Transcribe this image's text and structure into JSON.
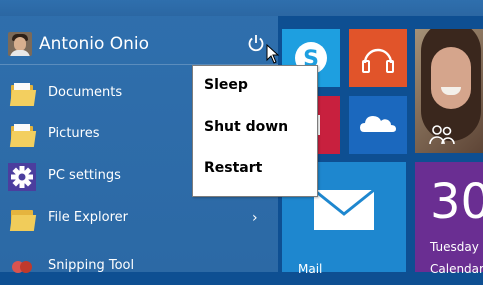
{
  "user": {
    "name": "Antonio Onio"
  },
  "power_menu": {
    "items": [
      "Sleep",
      "Shut down",
      "Restart"
    ]
  },
  "left_menu": {
    "items": [
      {
        "label": "Documents",
        "icon": "documents-folder-icon"
      },
      {
        "label": "Pictures",
        "icon": "pictures-folder-icon"
      },
      {
        "label": "PC settings",
        "icon": "gear-icon"
      },
      {
        "label": "File Explorer",
        "icon": "file-explorer-icon",
        "has_arrow": true
      },
      {
        "label": "Snipping Tool",
        "icon": "snipping-tool-icon"
      }
    ]
  },
  "tiles": {
    "calendar": {
      "day_number": "30",
      "weekday": "Tuesday",
      "app_label": "Calendar"
    },
    "mail": {
      "label": "Mail"
    }
  },
  "colors": {
    "start_menu_bg": "#2d6ba8",
    "skype": "#1e9fe0",
    "music": "#e1542a",
    "onedrive": "#1b68be",
    "mail": "#1e87cf",
    "calendar": "#6a2e92",
    "red_tile": "#c8203e"
  }
}
